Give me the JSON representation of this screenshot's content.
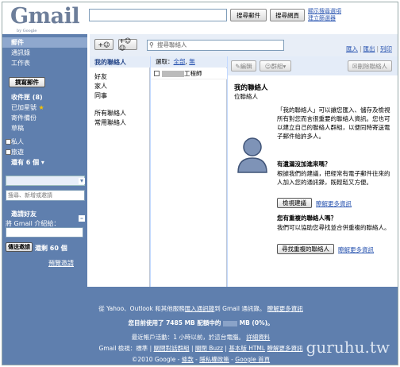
{
  "logo": {
    "text": "Gmail",
    "byline": "by Google"
  },
  "header": {
    "search_mail_btn": "搜尋郵件",
    "search_web_btn": "搜尋網頁",
    "link_show_options": "顯示搜尋選項",
    "link_create_filter": "建立篩選器"
  },
  "sidebar": {
    "items": [
      {
        "label": "郵件"
      },
      {
        "label": "通訊錄"
      },
      {
        "label": "工作表"
      }
    ],
    "compose": "撰寫郵件",
    "folders": [
      {
        "label": "收件匣 (8)"
      },
      {
        "label": "已加星號"
      },
      {
        "label": "寄件備份"
      },
      {
        "label": "草稿"
      }
    ],
    "labels": [
      {
        "label": "私人"
      },
      {
        "label": "旅遊"
      }
    ],
    "more_labels": "還有 6 個 ▾",
    "chat_search_placeholder": "搜尋、新增或邀請",
    "invite": {
      "title": "邀請好友",
      "subtitle": "將 Gmail 介紹給：",
      "send_btn": "傳送邀請",
      "remaining": "還剩 60 個",
      "preview": "預覽邀請"
    }
  },
  "contacts": {
    "search_placeholder": "搜尋聯絡人",
    "links": {
      "import": "匯入",
      "export": "匯出",
      "print": "列印"
    },
    "groups": [
      {
        "label": "我的聯絡人"
      },
      {
        "label": "好友"
      },
      {
        "label": "家人"
      },
      {
        "label": "同事"
      },
      {
        "label": "所有聯絡人"
      },
      {
        "label": "常用聯絡人"
      }
    ],
    "select_bar": {
      "prefix": "選取：",
      "all": "全部",
      "none": "無"
    },
    "list": [
      {
        "title": "工程師"
      }
    ],
    "toolbar": {
      "edit": "編輯",
      "group": "群組",
      "delete": "刪除聯絡人"
    },
    "detail": {
      "title": "我的聯絡人",
      "count": "位聯絡人",
      "para1": "「我的聯絡人」可以讓您匯入、儲存及檢視所有對您而言很重要的聯絡人資訊。您也可以建立自己的聯絡人群組，以便同時寄送電子郵件給許多人。",
      "q1_title": "有遺漏沒加進來嗎？",
      "q1_body": "根據我們的建議，把經常有電子郵件往來的人加入您的通訊錄，既輕鬆又方便。",
      "q1_btn": "檢視建議",
      "q1_link": "瞭解更多資訊",
      "q2_title": "您有重複的聯絡人嗎？",
      "q2_body": "我們可以協助您尋找並合併重複的聯絡人。",
      "q2_btn": "尋找重複的聯絡人",
      "q2_link": "瞭解更多資訊"
    }
  },
  "footer": {
    "line1_a": "從 Yahoo、Outlook 和其他服務",
    "line1_link": "匯入通訊錄",
    "line1_b": "到 Gmail 通訊錄。",
    "line1_more": "瞭解更多資訊",
    "line2_a": "您目前使用了",
    "line2_mb": "7485 MB",
    "line2_b": "配額中的",
    "line2_c": "MB (0%)。",
    "line3_a": "最近帳戶活動：1 小時以前，於這台電腦。",
    "line3_link": "詳細資料",
    "line4_a": "Gmail 檢視：標準",
    "line4_b": "關閉對話群組",
    "line4_c": "關閉 Buzz",
    "line4_d": "基本版 HTML",
    "line4_e": "瞭解更多資訊",
    "line5_a": "©2010 Google -",
    "line5_b": "條款",
    "line5_c": "隱私權政策",
    "line5_d": "Google 首頁",
    "watermark": "guruhu.tw"
  }
}
